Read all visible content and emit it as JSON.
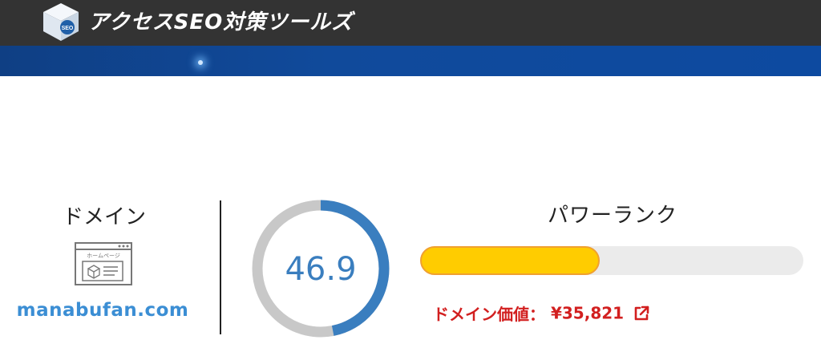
{
  "header": {
    "brand": "アクセスSEO対策ツールズ",
    "logo_badge": "SEO",
    "logo_icon": "cube-logo-icon"
  },
  "domain_section": {
    "title": "ドメイン",
    "icon": "homepage-icon",
    "icon_label": "ホームページ",
    "domain": "manabufan.com"
  },
  "score": {
    "value": "46.9",
    "fraction": 0.469,
    "colors": {
      "arc": "#3a7ebf",
      "track": "#c8c8c8"
    }
  },
  "power_rank": {
    "title": "パワーランク",
    "bar_fraction": 0.469,
    "colors": {
      "fill": "#ffcc00",
      "border": "#f0a030",
      "track": "#ebebeb"
    },
    "value_label": "ドメイン価値：",
    "value": "¥35,821",
    "link_icon": "external-link-icon"
  }
}
